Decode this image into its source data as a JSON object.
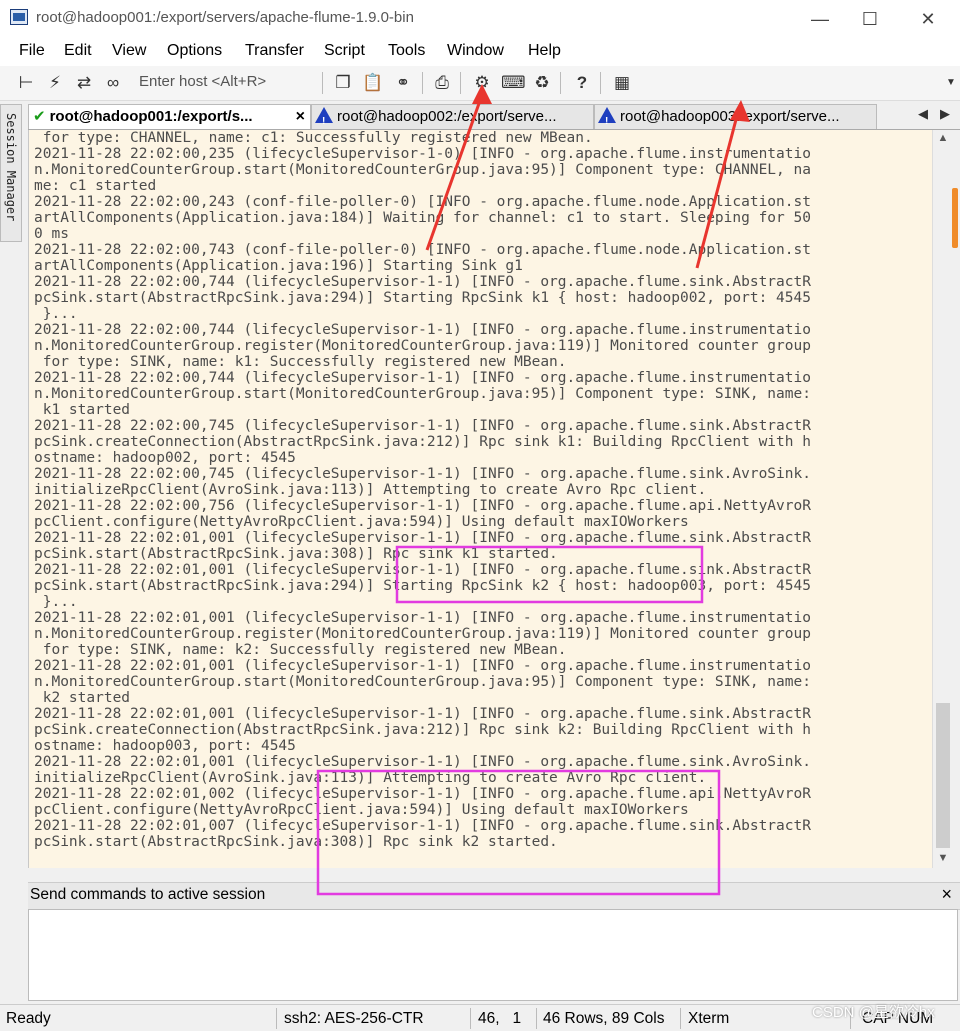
{
  "window": {
    "title": "root@hadoop001:/export/servers/apache-flume-1.9.0-bin"
  },
  "menu": [
    "File",
    "Edit",
    "View",
    "Options",
    "Transfer",
    "Script",
    "Tools",
    "Window",
    "Help"
  ],
  "toolbar": {
    "host_placeholder": "Enter host <Alt+R>"
  },
  "side_tab": {
    "label": "Session Manager"
  },
  "tabs": [
    {
      "label": "root@hadoop001:/export/s...",
      "status": "connected",
      "close": "×"
    },
    {
      "label": "root@hadoop002:/export/serve...",
      "status": "disconnected"
    },
    {
      "label": "root@hadoop003:/export/serve...",
      "status": "disconnected"
    }
  ],
  "terminal": {
    "lines": [
      " for type: CHANNEL, name: c1: Successfully registered new MBean.",
      "2021-11-28 22:02:00,235 (lifecycleSupervisor-1-0) [INFO - org.apache.flume.instrumentatio",
      "n.MonitoredCounterGroup.start(MonitoredCounterGroup.java:95)] Component type: CHANNEL, na",
      "me: c1 started",
      "2021-11-28 22:02:00,243 (conf-file-poller-0) [INFO - org.apache.flume.node.Application.st",
      "artAllComponents(Application.java:184)] Waiting for channel: c1 to start. Sleeping for 50",
      "0 ms",
      "2021-11-28 22:02:00,743 (conf-file-poller-0) [INFO - org.apache.flume.node.Application.st",
      "artAllComponents(Application.java:196)] Starting Sink g1",
      "2021-11-28 22:02:00,744 (lifecycleSupervisor-1-1) [INFO - org.apache.flume.sink.AbstractR",
      "pcSink.start(AbstractRpcSink.java:294)] Starting RpcSink k1 { host: hadoop002, port: 4545",
      " }...",
      "2021-11-28 22:02:00,744 (lifecycleSupervisor-1-1) [INFO - org.apache.flume.instrumentatio",
      "n.MonitoredCounterGroup.register(MonitoredCounterGroup.java:119)] Monitored counter group",
      " for type: SINK, name: k1: Successfully registered new MBean.",
      "2021-11-28 22:02:00,744 (lifecycleSupervisor-1-1) [INFO - org.apache.flume.instrumentatio",
      "n.MonitoredCounterGroup.start(MonitoredCounterGroup.java:95)] Component type: SINK, name:",
      " k1 started",
      "2021-11-28 22:02:00,745 (lifecycleSupervisor-1-1) [INFO - org.apache.flume.sink.AbstractR",
      "pcSink.createConnection(AbstractRpcSink.java:212)] Rpc sink k1: Building RpcClient with h",
      "ostname: hadoop002, port: 4545",
      "2021-11-28 22:02:00,745 (lifecycleSupervisor-1-1) [INFO - org.apache.flume.sink.AvroSink.",
      "initializeRpcClient(AvroSink.java:113)] Attempting to create Avro Rpc client.",
      "2021-11-28 22:02:00,756 (lifecycleSupervisor-1-1) [INFO - org.apache.flume.api.NettyAvroR",
      "pcClient.configure(NettyAvroRpcClient.java:594)] Using default maxIOWorkers",
      "2021-11-28 22:02:01,001 (lifecycleSupervisor-1-1) [INFO - org.apache.flume.sink.AbstractR",
      "pcSink.start(AbstractRpcSink.java:308)] Rpc sink k1 started.",
      "2021-11-28 22:02:01,001 (lifecycleSupervisor-1-1) [INFO - org.apache.flume.sink.AbstractR",
      "pcSink.start(AbstractRpcSink.java:294)] Starting RpcSink k2 { host: hadoop003, port: 4545",
      " }...",
      "2021-11-28 22:02:01,001 (lifecycleSupervisor-1-1) [INFO - org.apache.flume.instrumentatio",
      "n.MonitoredCounterGroup.register(MonitoredCounterGroup.java:119)] Monitored counter group",
      " for type: SINK, name: k2: Successfully registered new MBean.",
      "2021-11-28 22:02:01,001 (lifecycleSupervisor-1-1) [INFO - org.apache.flume.instrumentatio",
      "n.MonitoredCounterGroup.start(MonitoredCounterGroup.java:95)] Component type: SINK, name:",
      " k2 started",
      "2021-11-28 22:02:01,001 (lifecycleSupervisor-1-1) [INFO - org.apache.flume.sink.AbstractR",
      "pcSink.createConnection(AbstractRpcSink.java:212)] Rpc sink k2: Building RpcClient with h",
      "ostname: hadoop003, port: 4545",
      "2021-11-28 22:02:01,001 (lifecycleSupervisor-1-1) [INFO - org.apache.flume.sink.AvroSink.",
      "initializeRpcClient(AvroSink.java:113)] Attempting to create Avro Rpc client.",
      "2021-11-28 22:02:01,002 (lifecycleSupervisor-1-1) [INFO - org.apache.flume.api.NettyAvroR",
      "pcClient.configure(NettyAvroRpcClient.java:594)] Using default maxIOWorkers",
      "2021-11-28 22:02:01,007 (lifecycleSupervisor-1-1) [INFO - org.apache.flume.sink.AbstractR",
      "pcSink.start(AbstractRpcSink.java:308)] Rpc sink k2 started."
    ]
  },
  "send_bar": {
    "label": "Send commands to active session",
    "close": "×"
  },
  "status": {
    "ready": "Ready",
    "cipher": "ssh2: AES-256-CTR",
    "cursor": "46,   1",
    "size": "46 Rows, 89 Cols",
    "term": "Xterm",
    "caps": "CAP NUM"
  },
  "watermark": "CSDN @星欲冷hx",
  "colors": {
    "terminal_bg": "#fdf5e4",
    "terminal_fg": "#4c4c4c",
    "annotation_arrow": "#e8352e",
    "annotation_box": "#e23be0"
  }
}
